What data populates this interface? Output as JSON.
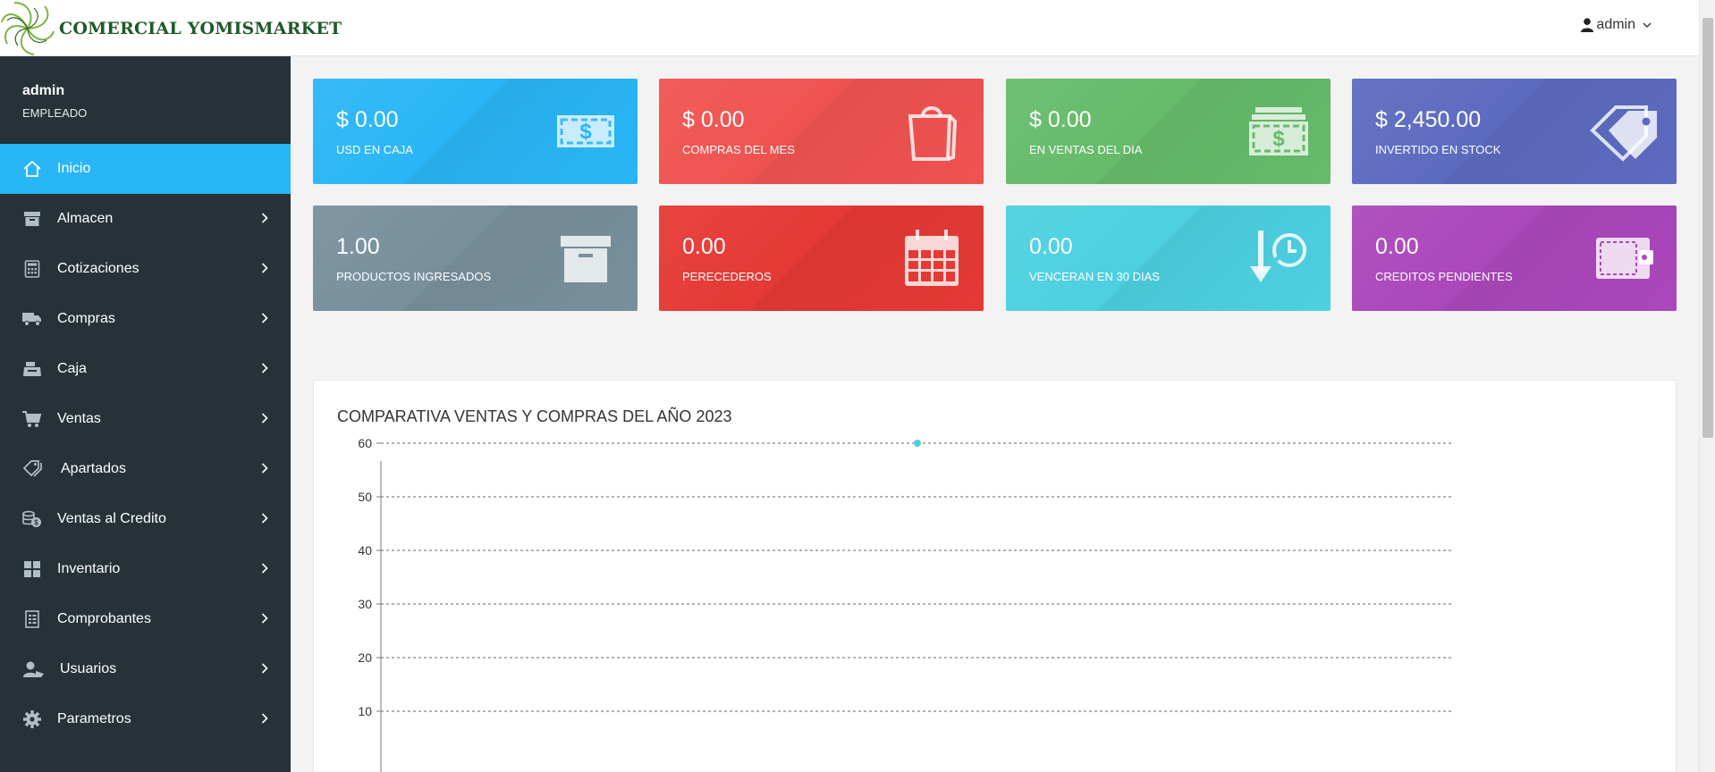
{
  "brand": {
    "name": "COMERCIAL YOMISMARKET"
  },
  "header": {
    "user_label": "admin"
  },
  "profile": {
    "name": "admin",
    "role": "EMPLEADO"
  },
  "sidebar": {
    "items": [
      {
        "label": "Inicio",
        "icon": "home-icon",
        "active": true
      },
      {
        "label": "Almacen",
        "icon": "archive-icon"
      },
      {
        "label": "Cotizaciones",
        "icon": "calculator-icon"
      },
      {
        "label": "Compras",
        "icon": "truck-icon"
      },
      {
        "label": "Caja",
        "icon": "cash-register-icon"
      },
      {
        "label": "Ventas",
        "icon": "cart-icon"
      },
      {
        "label": "Apartados",
        "icon": "tags-icon"
      },
      {
        "label": "Ventas al Credito",
        "icon": "coins-icon"
      },
      {
        "label": "Inventario",
        "icon": "grid-icon"
      },
      {
        "label": "Comprobantes",
        "icon": "receipt-icon"
      },
      {
        "label": "Usuarios",
        "icon": "users-icon"
      },
      {
        "label": "Parametros",
        "icon": "gear-icon"
      }
    ]
  },
  "cards": [
    {
      "value": "$ 0.00",
      "label": "USD EN CAJA",
      "color": "#29b6f6",
      "icon": "money-bill-icon"
    },
    {
      "value": "$ 0.00",
      "label": "COMPRAS DEL MES",
      "color": "#ef5350",
      "icon": "shopping-bag-icon"
    },
    {
      "value": "$ 0.00",
      "label": "EN VENTAS DEL DIA",
      "color": "#66bb6a",
      "icon": "money-stack-icon"
    },
    {
      "value": "$ 2,450.00",
      "label": "INVERTIDO EN STOCK",
      "color": "#5c6bc0",
      "icon": "tag-icon"
    },
    {
      "value": "1.00",
      "label": "PRODUCTOS INGRESADOS",
      "color": "#78909c",
      "icon": "box-icon"
    },
    {
      "value": "0.00",
      "label": "PERECEDEROS",
      "color": "#e53935",
      "icon": "calendar-icon"
    },
    {
      "value": "0.00",
      "label": "VENCERAN EN 30 DIAS",
      "color": "#4dd0e1",
      "icon": "clock-arrow-icon"
    },
    {
      "value": "0.00",
      "label": "CREDITOS PENDIENTES",
      "color": "#ab47bc",
      "icon": "wallet-icon"
    }
  ],
  "chart_panel": {
    "title": "COMPARATIVA VENTAS Y COMPRAS DEL AÑO 2023"
  },
  "chart_data": {
    "type": "line",
    "title": "COMPARATIVA VENTAS Y COMPRAS DEL AÑO 2023",
    "ylim": [
      0,
      60
    ],
    "yticks": [
      10,
      20,
      30,
      40,
      50,
      60
    ],
    "grid": true,
    "series": [
      {
        "color": "#4dd0e1",
        "points": [
          {
            "x": 0.5,
            "y": 60
          }
        ]
      }
    ],
    "xlim": [
      0,
      1
    ]
  }
}
